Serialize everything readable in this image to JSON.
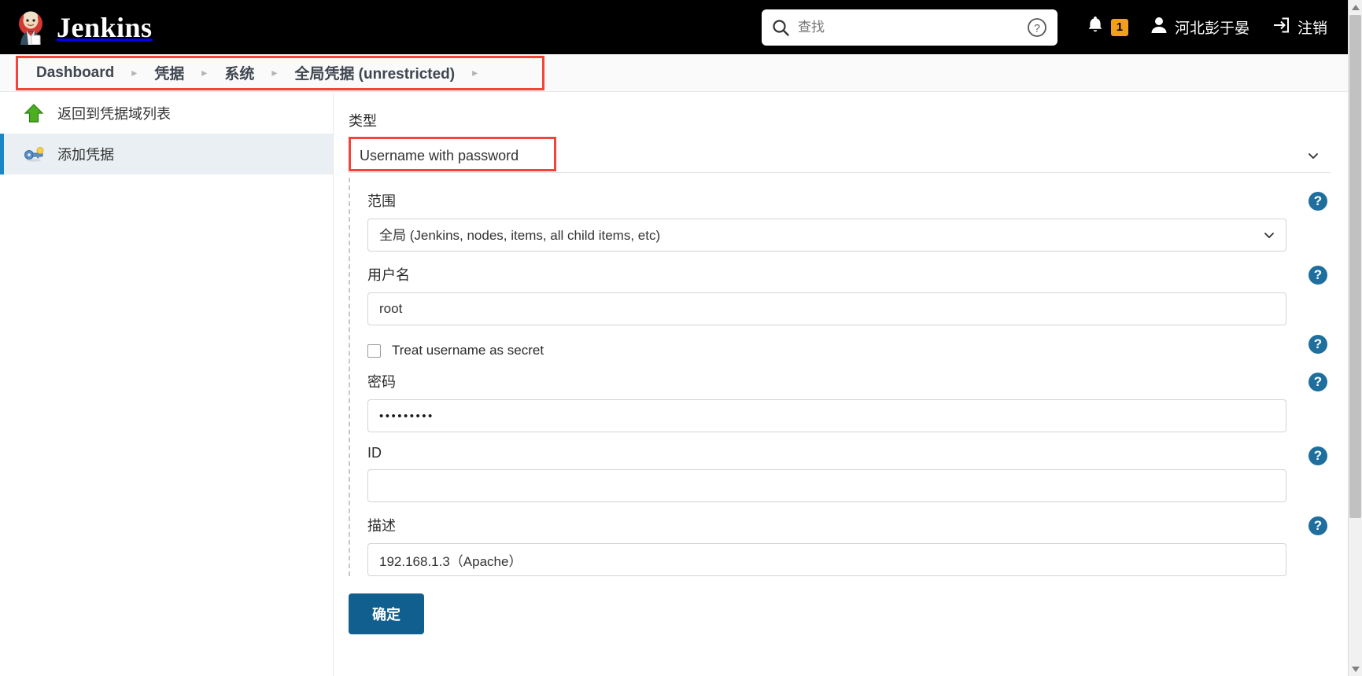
{
  "header": {
    "brand": "Jenkins",
    "logo_icon": "jenkins-butler-icon",
    "search": {
      "placeholder": "查找",
      "value": "",
      "icon": "search-icon",
      "help_icon": "help-circle-icon"
    },
    "notifications": {
      "icon": "bell-icon",
      "count": "1"
    },
    "user": {
      "icon": "person-icon",
      "name": "河北彭于晏"
    },
    "logout": {
      "icon": "logout-icon",
      "label": "注销"
    }
  },
  "breadcrumb": {
    "items": [
      "Dashboard",
      "凭据",
      "系统",
      "全局凭据 (unrestricted)"
    ],
    "separator": "▸",
    "trailing_separator": "▸",
    "highlight_color": "#f4433a"
  },
  "sidebar": {
    "items": [
      {
        "label": "返回到凭据域列表",
        "icon": "up-arrow-green-icon",
        "active": false
      },
      {
        "label": "添加凭据",
        "icon": "key-icon",
        "active": true
      }
    ],
    "active_accent": "#1b86c4",
    "active_background": "#e9eff2"
  },
  "form": {
    "type": {
      "label": "类型",
      "value": "Username with password",
      "highlight_color": "#f4433a",
      "chevron_icon": "chevron-down-icon"
    },
    "fields": [
      {
        "name": "scope",
        "label": "范围",
        "control": "select",
        "value": "全局 (Jenkins, nodes, items, all child items, etc)",
        "help_icon": "help-circle-icon",
        "chevron_icon": "chevron-down-icon"
      },
      {
        "name": "username",
        "label": "用户名",
        "control": "text",
        "value": "root",
        "placeholder": "",
        "help_icon": "help-circle-icon"
      },
      {
        "name": "treat-username-as-secret",
        "label": "Treat username as secret",
        "control": "checkbox",
        "checked": false,
        "help_icon": "help-circle-icon"
      },
      {
        "name": "password",
        "label": "密码",
        "control": "password",
        "value": "•••••••••",
        "placeholder": "",
        "help_icon": "help-circle-icon"
      },
      {
        "name": "id",
        "label": "ID",
        "control": "text",
        "value": "",
        "placeholder": "",
        "help_icon": "help-circle-icon"
      },
      {
        "name": "description",
        "label": "描述",
        "control": "text",
        "value": "192.168.1.3（Apache）",
        "placeholder": "",
        "help_icon": "help-circle-icon"
      }
    ],
    "submit": {
      "label": "确定",
      "color": "#115f8e"
    }
  },
  "scrollbar": {
    "up_icon": "caret-up-icon",
    "down_icon": "caret-down-icon"
  }
}
